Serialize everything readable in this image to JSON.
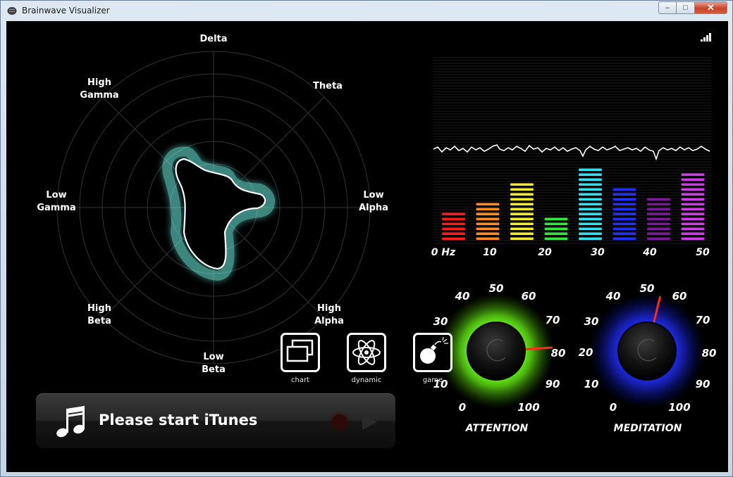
{
  "window": {
    "title": "Brainwave Visualizer",
    "controls": {
      "minimize": "–",
      "maximize": "□",
      "close": "✕"
    }
  },
  "radar": {
    "labels": {
      "delta": "Delta",
      "theta": "Theta",
      "low_alpha_1": "Low",
      "low_alpha_2": "Alpha",
      "high_alpha_1": "High",
      "high_alpha_2": "Alpha",
      "low_beta_1": "Low",
      "low_beta_2": "Beta",
      "high_beta_1": "High",
      "high_beta_2": "Beta",
      "low_gamma_1": "Low",
      "low_gamma_2": "Gamma",
      "high_gamma_1": "High",
      "high_gamma_2": "Gamma"
    },
    "shape_color": "#6ff5e6"
  },
  "spectrum": {
    "xlabels": [
      "0 Hz",
      "10",
      "20",
      "30",
      "40",
      "50"
    ],
    "bar_colors": [
      "#ff1a1a",
      "#ff8a1e",
      "#f2ec2c",
      "#2ee83a",
      "#2ee2f2",
      "#2030ff",
      "#7a1a9a",
      "#d03ae8"
    ],
    "bar_levels": [
      0.32,
      0.44,
      0.69,
      0.26,
      0.83,
      0.64,
      0.52,
      0.78
    ]
  },
  "gauges": {
    "attention": {
      "label": "ATTENTION",
      "value": 82,
      "glow": "#6cff1a",
      "ticks": [
        "0",
        "10",
        "20",
        "30",
        "40",
        "50",
        "60",
        "70",
        "80",
        "90",
        "100"
      ]
    },
    "meditation": {
      "label": "MEDITATION",
      "value": 55,
      "glow": "#1a2aff",
      "ticks": [
        "0",
        "10",
        "20",
        "30",
        "40",
        "50",
        "60",
        "70",
        "80",
        "90",
        "100"
      ]
    }
  },
  "modes": {
    "chart": {
      "label": "chart",
      "icon": "chart-icon"
    },
    "dynamic": {
      "label": "dynamic",
      "icon": "atom-icon"
    },
    "game": {
      "label": "game",
      "icon": "bomb-icon"
    }
  },
  "itunes": {
    "message": "Please start iTunes",
    "icon": "music-note-icon"
  }
}
